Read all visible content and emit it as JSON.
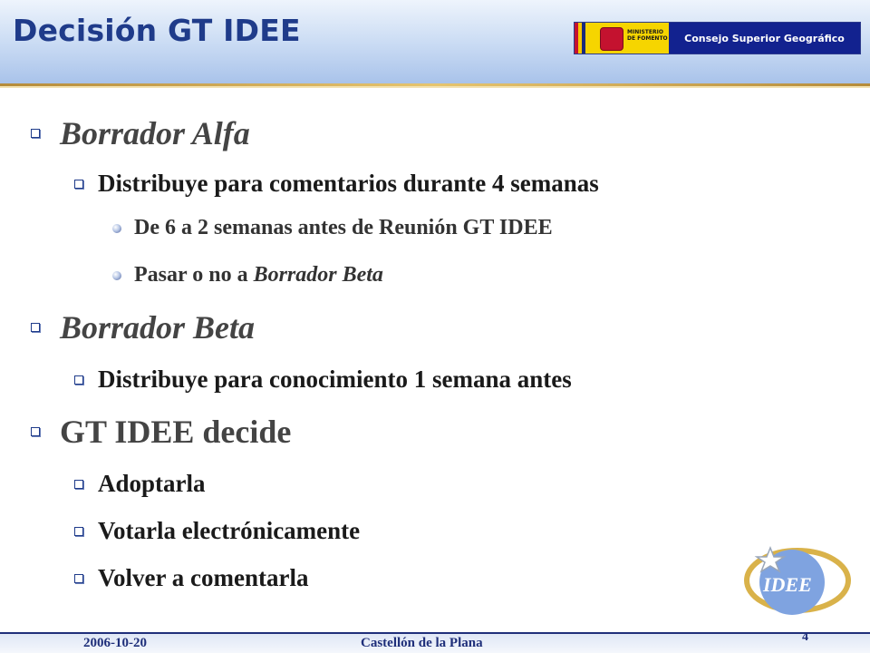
{
  "header": {
    "title": "Decisión GT IDEE",
    "logo": {
      "ministry_label": "MINISTERIO DE FOMENTO",
      "council_label": "Consejo Superior Geográfico"
    }
  },
  "content": {
    "items": [
      {
        "level": 1,
        "text": "Borrador Alfa"
      },
      {
        "level": 2,
        "text": "Distribuye para comentarios durante 4 semanas"
      },
      {
        "level": 3,
        "text": "De 6 a 2 semanas antes de Reunión GT IDEE"
      },
      {
        "level": 3,
        "prefix": "Pasar o no a ",
        "emphasis": "Borrador Beta"
      },
      {
        "level": 1,
        "text": "Borrador Beta"
      },
      {
        "level": 2,
        "text": "Distribuye para conocimiento 1 semana antes"
      },
      {
        "level": 1,
        "text": "GT IDEE decide"
      },
      {
        "level": 2,
        "text": "Adoptarla"
      },
      {
        "level": 2,
        "text": "Votarla electrónicamente"
      },
      {
        "level": 2,
        "text": "Volver a comentarla"
      }
    ]
  },
  "brand": {
    "idee_logo_text": "IDEE"
  },
  "footer": {
    "date": "2006-10-20",
    "place": "Castellón de la Plana",
    "slide_number": "4"
  },
  "colors": {
    "title": "#1f3b8a",
    "council_bg": "#12228f",
    "footer_text": "#1f2f7a",
    "idee_circle": "#7fa3e0",
    "idee_ring": "#d9b24a"
  }
}
